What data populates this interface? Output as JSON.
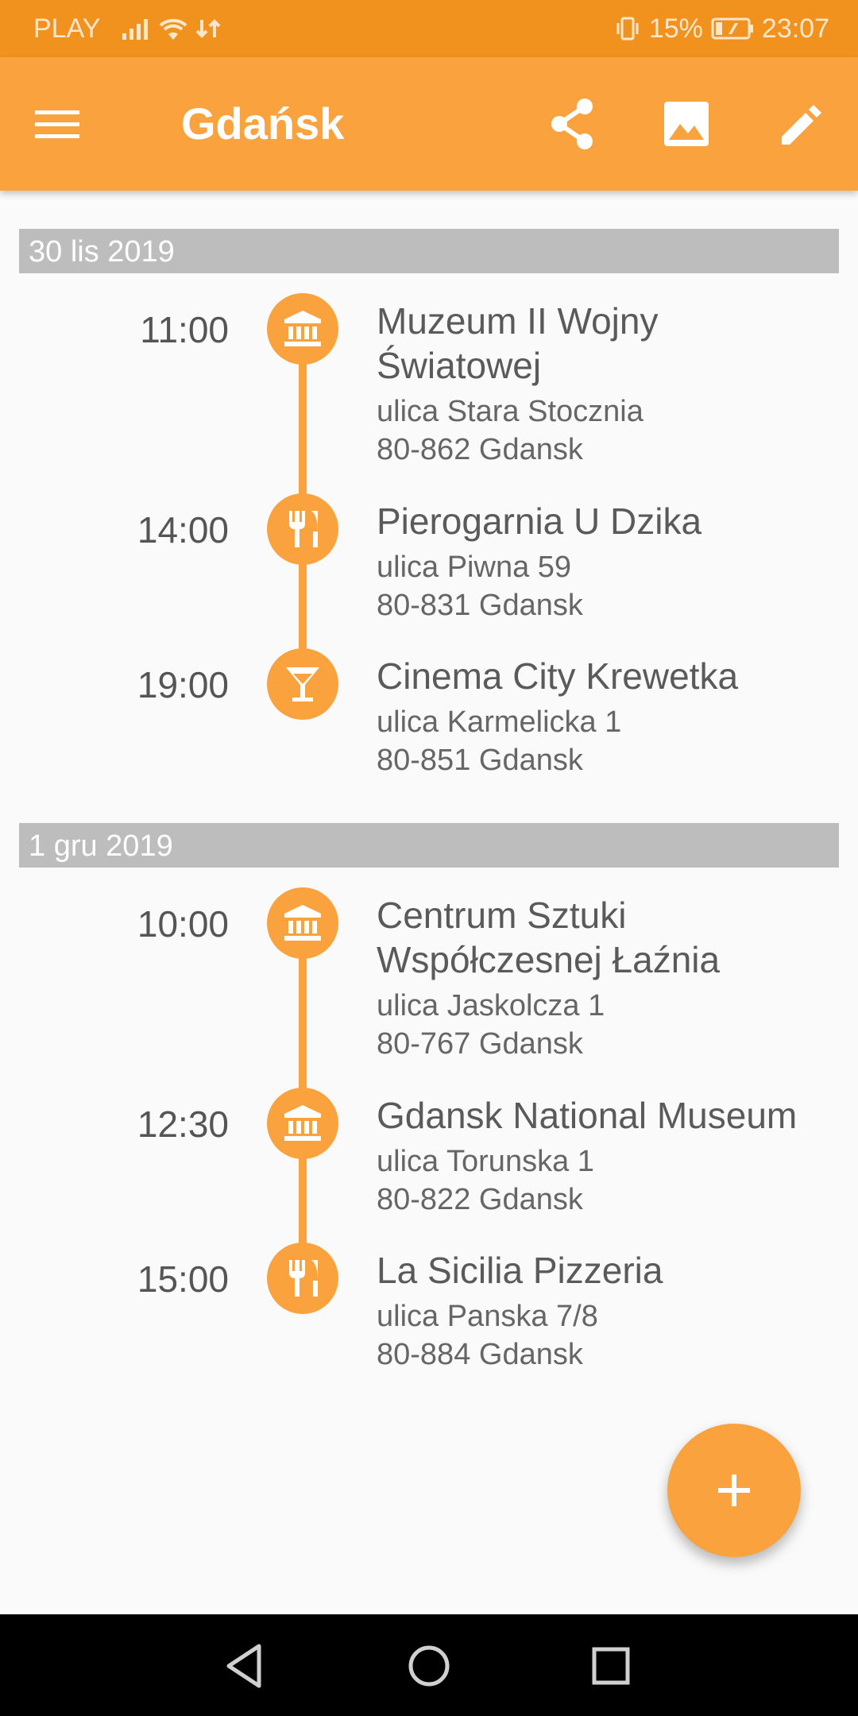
{
  "status_bar": {
    "carrier": "PLAY",
    "battery": "15%",
    "time": "23:07"
  },
  "app_bar": {
    "title": "Gdańsk",
    "menu_icon": "menu-icon",
    "actions": [
      "share-icon",
      "image-icon",
      "edit-icon"
    ]
  },
  "days": [
    {
      "date": "30 lis 2019",
      "events": [
        {
          "time": "11:00",
          "icon": "museum-icon",
          "name_line1": "Muzeum II Wojny",
          "name_line2": "Światowej",
          "street": "ulica Stara Stocznia",
          "city": "80-862 Gdansk"
        },
        {
          "time": "14:00",
          "icon": "restaurant-icon",
          "name_line1": "Pierogarnia U Dzika",
          "street": "ulica Piwna 59",
          "city": "80-831 Gdansk"
        },
        {
          "time": "19:00",
          "icon": "bar-icon",
          "name_line1": "Cinema City Krewetka",
          "street": "ulica Karmelicka 1",
          "city": "80-851 Gdansk"
        }
      ]
    },
    {
      "date": "1 gru 2019",
      "events": [
        {
          "time": "10:00",
          "icon": "museum-icon",
          "name_line1": "Centrum Sztuki",
          "name_line2": "Współczesnej Łaźnia",
          "street": "ulica Jaskolcza 1",
          "city": "80-767 Gdansk"
        },
        {
          "time": "12:30",
          "icon": "museum-icon",
          "name_line1": "Gdansk National Museum",
          "street": "ulica Torunska 1",
          "city": "80-822 Gdansk"
        },
        {
          "time": "15:00",
          "icon": "restaurant-icon",
          "name_line1": "La Sicilia Pizzeria",
          "street": "ulica Panska 7/8",
          "city": "80-884 Gdansk"
        }
      ]
    }
  ],
  "fab": {
    "icon": "add-icon"
  },
  "colors": {
    "status_bar": "#f1921f",
    "app_bar": "#f9a23e",
    "accent": "#f9a23e",
    "day_header": "#bdbdbd"
  }
}
